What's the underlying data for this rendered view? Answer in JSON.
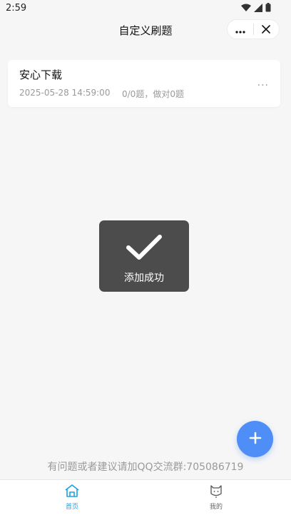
{
  "status_bar": {
    "time": "2:59",
    "icons": [
      "wifi-icon",
      "signal-icon",
      "battery-icon"
    ]
  },
  "nav": {
    "title": "自定义刷题",
    "more_icon": "more-icon",
    "close_icon": "close-icon"
  },
  "card": {
    "title": "安心下载",
    "date": "2025-05-28 14:59:00",
    "stats": "0/0题，做对0题",
    "more_label": "···"
  },
  "toast": {
    "icon": "checkmark-icon",
    "text": "添加成功"
  },
  "fab": {
    "icon": "plus-icon",
    "color": "#4f8ef7"
  },
  "footer": {
    "note": "有问题或者建议请加QQ交流群:705086719"
  },
  "tab_bar": {
    "tabs": [
      {
        "label": "首页",
        "icon": "home-icon",
        "active": true,
        "color": "#1aa0e6"
      },
      {
        "label": "我的",
        "icon": "cat-face-icon",
        "active": false,
        "color": "#666666"
      }
    ]
  }
}
